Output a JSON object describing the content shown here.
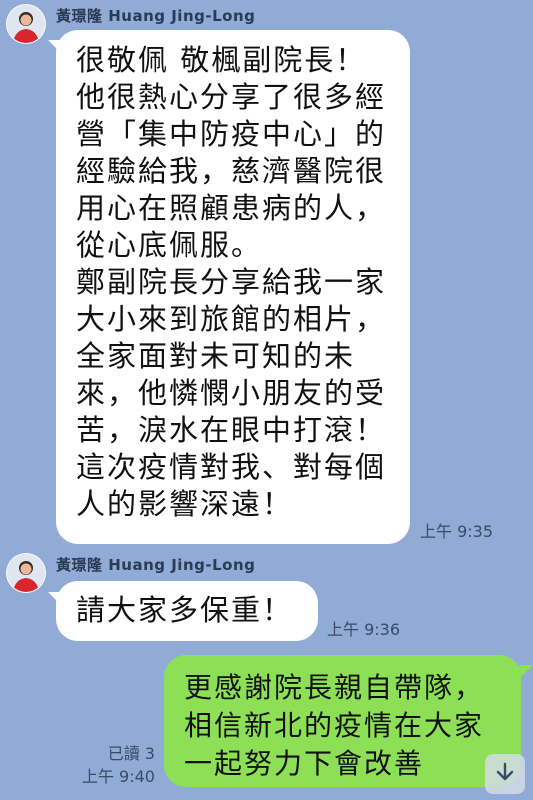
{
  "messages": [
    {
      "sender": "黃璟隆 Huang Jing-Long",
      "text": "很敬佩 敬楓副院長！\n他很熱心分享了很多經\n營「集中防疫中心」的\n經驗給我，慈濟醫院很\n用心在照顧患病的人，\n從心底佩服。\n鄭副院長分享給我一家\n大小來到旅館的相片，\n全家面對未可知的未\n來，他憐憫小朋友的受\n苦，淚水在眼中打滾！\n這次疫情對我、對每個\n人的影響深遠！",
      "time": "上午 9:35"
    },
    {
      "sender": "黃璟隆 Huang Jing-Long",
      "text": "請大家多保重！",
      "time": "上午 9:36"
    },
    {
      "text": "更感謝院長親自帶隊，\n相信新北的疫情在大家\n一起努力下會改善",
      "read": "已讀 3",
      "time": "上午 9:40"
    }
  ],
  "icons": {
    "scroll_down": "arrow-down-icon",
    "avatar": "avatar"
  },
  "colors": {
    "background": "#8fabd6",
    "incoming_bubble": "#ffffff",
    "outgoing_bubble": "#8de055"
  }
}
